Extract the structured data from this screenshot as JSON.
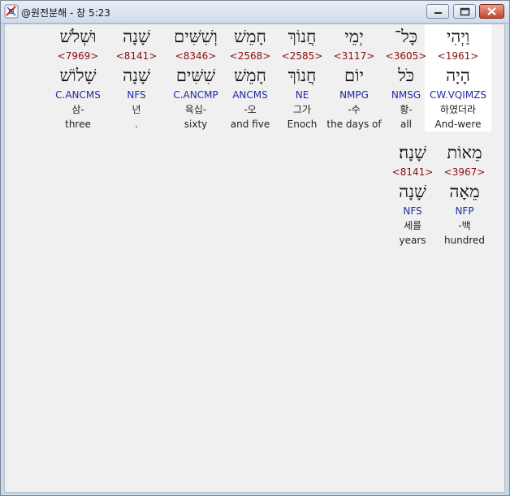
{
  "window": {
    "title": "@원전분해 - 창 5:23",
    "icons": {
      "app": "bible-app-icon",
      "minimize": "minimize-icon",
      "maximize": "maximize-icon",
      "close": "close-icon"
    }
  },
  "colors": {
    "hebrew": "#111111",
    "strong": "#8b0d0d",
    "parsing": "#1f2aa6",
    "gloss": "#222222",
    "selected_bg": "#ffffff"
  },
  "words": [
    {
      "hebrew": "וַיְהִי",
      "strong": "<1961>",
      "lemma": "הָיָה",
      "parsing": "CW.VQIMZS",
      "korean": "하였더라",
      "english": "And-were",
      "selected": true
    },
    {
      "hebrew": "כָּל־",
      "strong": "<3605>",
      "lemma": "כֹּל",
      "parsing": "NMSG",
      "korean": "황-",
      "english": "all",
      "selected": false
    },
    {
      "hebrew": "יְמֵי",
      "strong": "<3117>",
      "lemma": "יוֹם",
      "parsing": "NMPG",
      "korean": "-수",
      "english": "the days of",
      "selected": false
    },
    {
      "hebrew": "חֲנוֹךְ",
      "strong": "<2585>",
      "lemma": "חֲנוֹךְ",
      "parsing": "NE",
      "korean": "그가",
      "english": "Enoch",
      "selected": false
    },
    {
      "hebrew": "חָמֵשׁ",
      "strong": "<2568>",
      "lemma": "חָמֵשׁ",
      "parsing": "ANCMS",
      "korean": "-오",
      "english": "and five",
      "selected": false
    },
    {
      "hebrew": "וְשִׁשִּׁים",
      "strong": "<8346>",
      "lemma": "שִׁשִּׁים",
      "parsing": "C.ANCMP",
      "korean": "육십-",
      "english": "sixty",
      "selected": false
    },
    {
      "hebrew": "שָׁנָה",
      "strong": "<8141>",
      "lemma": "שָׁנָה",
      "parsing": "NFS",
      "korean": "년",
      "english": ".",
      "selected": false
    },
    {
      "hebrew": "וּשְׁלֹשׁ",
      "strong": "<7969>",
      "lemma": "שָׁלוֹשׁ",
      "parsing": "C.ANCMS",
      "korean": "삼-",
      "english": "three",
      "selected": false
    },
    {
      "hebrew": "מֵאוֹת",
      "strong": "<3967>",
      "lemma": "מֵאָה",
      "parsing": "NFP",
      "korean": "-백",
      "english": "hundred",
      "selected": false
    },
    {
      "hebrew": "שָׁנָה׃",
      "strong": "<8141>",
      "lemma": "שָׁנָה",
      "parsing": "NFS",
      "korean": "세를",
      "english": "years",
      "selected": false
    }
  ]
}
